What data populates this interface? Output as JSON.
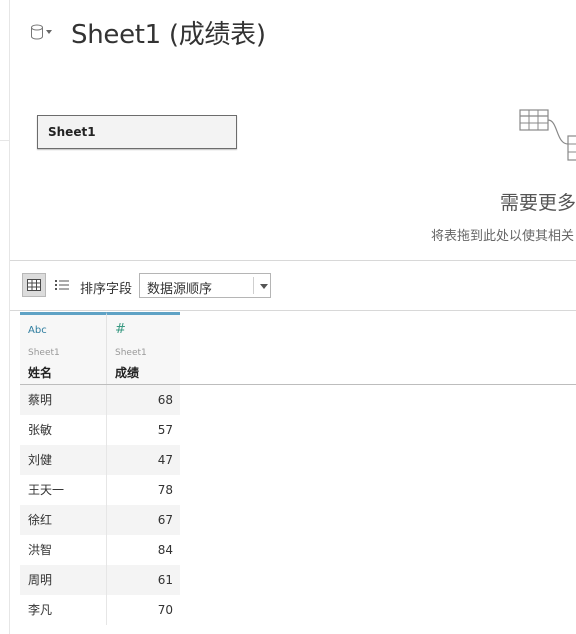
{
  "header": {
    "title": "Sheet1 (成绩表)",
    "datasource_icon": "database-cylinder-icon"
  },
  "canvas": {
    "table_pill_label": "Sheet1",
    "illustration_icon": "joined-tables-icon",
    "need_more_text": "需要更多数",
    "drag_hint_text": "将表拖到此处以使其相关"
  },
  "toolbar": {
    "grid_view_icon": "grid-view-icon",
    "list_view_icon": "list-view-icon",
    "sort_label": "排序字段",
    "sort_value": "数据源顺序"
  },
  "grid": {
    "columns": [
      {
        "type_glyph": "Abc",
        "source": "Sheet1",
        "field": "姓名"
      },
      {
        "type_glyph": "#",
        "source": "Sheet1",
        "field": "成绩"
      }
    ],
    "rows": [
      {
        "name": "蔡明",
        "score": "68"
      },
      {
        "name": "张敏",
        "score": "57"
      },
      {
        "name": "刘健",
        "score": "47"
      },
      {
        "name": "王天一",
        "score": "78"
      },
      {
        "name": "徐红",
        "score": "67"
      },
      {
        "name": "洪智",
        "score": "84"
      },
      {
        "name": "周明",
        "score": "61"
      },
      {
        "name": "李凡",
        "score": "70"
      }
    ]
  }
}
